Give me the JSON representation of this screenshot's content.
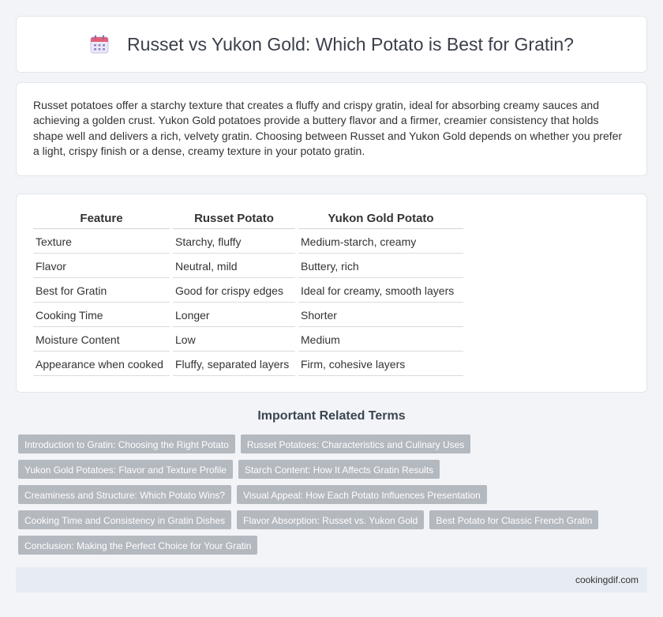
{
  "header": {
    "title": "Russet vs Yukon Gold: Which Potato is Best for Gratin?",
    "icon": "calendar-icon"
  },
  "intro": {
    "text": "Russet potatoes offer a starchy texture that creates a fluffy and crispy gratin, ideal for absorbing creamy sauces and achieving a golden crust. Yukon Gold potatoes provide a buttery flavor and a firmer, creamier consistency that holds shape well and delivers a rich, velvety gratin. Choosing between Russet and Yukon Gold depends on whether you prefer a light, crispy finish or a dense, creamy texture in your potato gratin."
  },
  "table": {
    "headers": [
      "Feature",
      "Russet Potato",
      "Yukon Gold Potato"
    ],
    "rows": [
      [
        "Texture",
        "Starchy, fluffy",
        "Medium-starch, creamy"
      ],
      [
        "Flavor",
        "Neutral, mild",
        "Buttery, rich"
      ],
      [
        "Best for Gratin",
        "Good for crispy edges",
        "Ideal for creamy, smooth layers"
      ],
      [
        "Cooking Time",
        "Longer",
        "Shorter"
      ],
      [
        "Moisture Content",
        "Low",
        "Medium"
      ],
      [
        "Appearance when cooked",
        "Fluffy, separated layers",
        "Firm, cohesive layers"
      ]
    ]
  },
  "related": {
    "heading": "Important Related Terms",
    "tags": [
      "Introduction to Gratin: Choosing the Right Potato",
      "Russet Potatoes: Characteristics and Culinary Uses",
      "Yukon Gold Potatoes: Flavor and Texture Profile",
      "Starch Content: How It Affects Gratin Results",
      "Creaminess and Structure: Which Potato Wins?",
      "Visual Appeal: How Each Potato Influences Presentation",
      "Cooking Time and Consistency in Gratin Dishes",
      "Flavor Absorption: Russet vs. Yukon Gold",
      "Best Potato for Classic French Gratin",
      "Conclusion: Making the Perfect Choice for Your Gratin"
    ]
  },
  "footer": {
    "site": "cookingdif.com"
  }
}
